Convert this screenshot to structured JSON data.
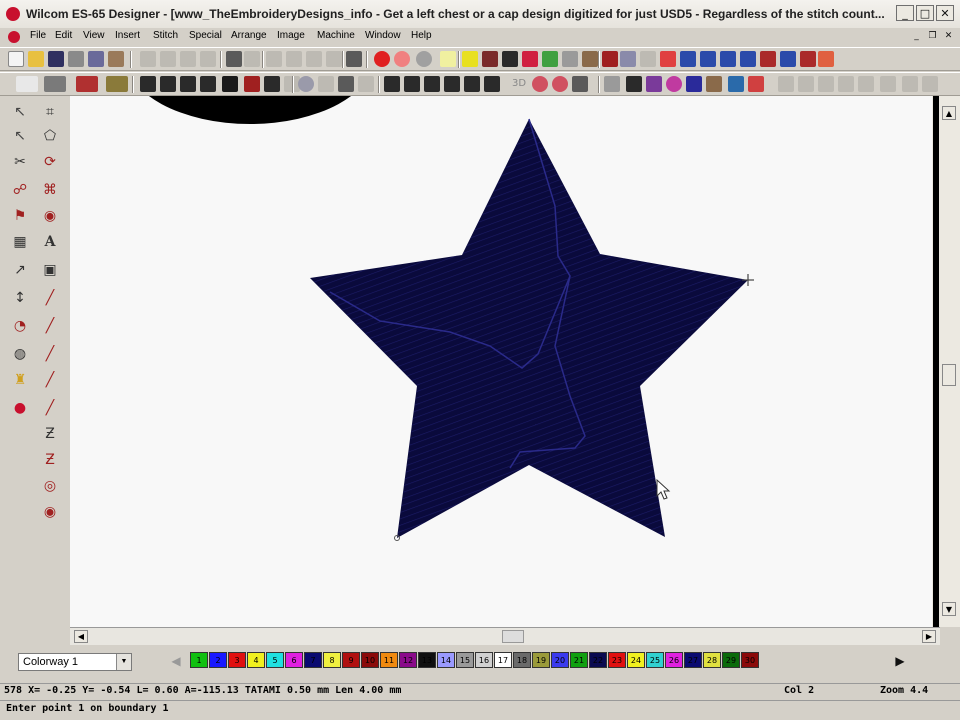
{
  "window": {
    "title": "Wilcom ES-65 Designer - [www_TheEmbroideryDesigns_info - Get a left chest or a cap design digitized for just USD5 - Regardless of the stitch count...",
    "minimize": "_",
    "maximize": "□",
    "close": "✕"
  },
  "menu": {
    "items": [
      "File",
      "Edit",
      "View",
      "Insert",
      "Stitch",
      "Special",
      "Arrange",
      "Image",
      "Machine",
      "Window",
      "Help"
    ],
    "mdi_minimize": "_",
    "mdi_restore": "❐",
    "mdi_close": "✕"
  },
  "toolbar2": {
    "label_3d": "3D"
  },
  "left_toolbar": {
    "text_tool_glyph": "A"
  },
  "design": {
    "fill_color": "#0a0a3c",
    "stitch_color": "#2a2a8a",
    "top_shape_color": "#000000"
  },
  "colorway": {
    "selected": "Colorway 1"
  },
  "palette": {
    "swatches": [
      {
        "label": "1",
        "color": "#10c010"
      },
      {
        "label": "2",
        "color": "#1818ff"
      },
      {
        "label": "3",
        "color": "#e01010"
      },
      {
        "label": "4",
        "color": "#f0f020"
      },
      {
        "label": "5",
        "color": "#20e0e0"
      },
      {
        "label": "6",
        "color": "#e020e0"
      },
      {
        "label": "7",
        "color": "#0a0a70"
      },
      {
        "label": "8",
        "color": "#f0f040"
      },
      {
        "label": "9",
        "color": "#b01010"
      },
      {
        "label": "10",
        "color": "#8a0a0a"
      },
      {
        "label": "11",
        "color": "#f08a10"
      },
      {
        "label": "12",
        "color": "#8a0a8a"
      },
      {
        "label": "13",
        "color": "#101010"
      },
      {
        "label": "14",
        "color": "#9a9aff"
      },
      {
        "label": "15",
        "color": "#9a9a9a"
      },
      {
        "label": "16",
        "color": "#d0d0d0"
      },
      {
        "label": "17",
        "color": "#ffffff"
      },
      {
        "label": "18",
        "color": "#6a6a6a"
      },
      {
        "label": "19",
        "color": "#9a9a3a"
      },
      {
        "label": "20",
        "color": "#3a3aee"
      },
      {
        "label": "21",
        "color": "#10a010"
      },
      {
        "label": "22",
        "color": "#0a0a50"
      },
      {
        "label": "23",
        "color": "#e01010"
      },
      {
        "label": "24",
        "color": "#f0f020"
      },
      {
        "label": "25",
        "color": "#30d0d0"
      },
      {
        "label": "26",
        "color": "#e020e0"
      },
      {
        "label": "27",
        "color": "#0a0a70"
      },
      {
        "label": "28",
        "color": "#e0e040"
      },
      {
        "label": "29",
        "color": "#0a6a0a"
      },
      {
        "label": "30",
        "color": "#8a0a0a"
      }
    ]
  },
  "status": {
    "readout": "578 X=  -0.25 Y=  -0.54 L=  0.60 A=-115.13 TATAMI  0.50 mm Len  4.00 mm",
    "col": "Col 2",
    "zoom": "Zoom 4.4",
    "prompt": "Enter point 1 on boundary 1"
  }
}
